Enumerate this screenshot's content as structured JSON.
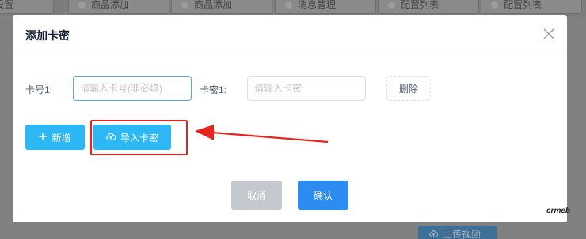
{
  "background": {
    "tabs": [
      "营销设置",
      "商品添加",
      "商品添加",
      "消息管理",
      "配置列表",
      "配置列表"
    ],
    "upload_button": "上传视频"
  },
  "dialog": {
    "title": "添加卡密",
    "row": {
      "card_no_label": "卡号1:",
      "card_no_placeholder": "请输入卡号(非必填)",
      "card_secret_label": "卡密1:",
      "card_secret_placeholder": "请输入卡密",
      "delete_label": "删除"
    },
    "add_label": "新增",
    "import_label": "导入卡密",
    "cancel_label": "取消",
    "confirm_label": "确认"
  },
  "watermark": "crmeb",
  "colors": {
    "accent": "#2db7f5",
    "primary": "#2d8cf0",
    "disabled": "#c5c8ce",
    "annotation": "#e8231c"
  },
  "icons": [
    "close-icon",
    "plus-icon",
    "cloud-upload-icon"
  ]
}
